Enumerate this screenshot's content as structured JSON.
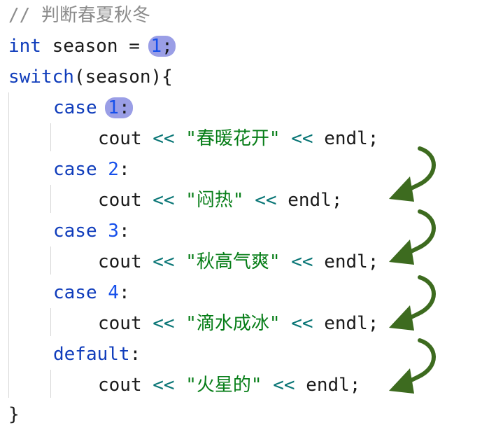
{
  "code": {
    "line1": {
      "comment": "// 判断春夏秋冬"
    },
    "line2": {
      "type": "int",
      "name": " season = ",
      "value": "1",
      "semi": ";"
    },
    "line3": {
      "kw": "switch",
      "rest": "(season){"
    },
    "line4": {
      "kw": "case",
      "value": "1",
      "colon": ":"
    },
    "line5": {
      "cout": "cout",
      "op1": "<<",
      "str": "\"春暖花开\"",
      "op2": "<<",
      "endl": "endl;"
    },
    "line6": {
      "kw": "case",
      "value": "2",
      "colon": ":"
    },
    "line7": {
      "cout": "cout",
      "op1": "<<",
      "str": "\"闷热\"",
      "op2": "<<",
      "endl": "endl;"
    },
    "line8": {
      "kw": "case",
      "value": "3",
      "colon": ":"
    },
    "line9": {
      "cout": "cout",
      "op1": "<<",
      "str": "\"秋高气爽\"",
      "op2": "<<",
      "endl": "endl;"
    },
    "line10": {
      "kw": "case",
      "value": "4",
      "colon": ":"
    },
    "line11": {
      "cout": "cout",
      "op1": "<<",
      "str": "\"滴水成冰\"",
      "op2": "<<",
      "endl": "endl;"
    },
    "line12": {
      "kw": "default",
      "colon": ":"
    },
    "line13": {
      "cout": "cout",
      "op1": "<<",
      "str": "\"火星的\"",
      "op2": "<<",
      "endl": "endl;"
    },
    "line14": {
      "brace": "}"
    }
  },
  "colors": {
    "keyword": "#0f3cbb",
    "number": "#1750eb",
    "operator": "#087575",
    "string": "#067d17",
    "comment": "#8c8c8c",
    "highlight": "#9a9ee6",
    "arrow": "#3d6b1f"
  },
  "icons": [
    "fallthrough-arrow-icon"
  ]
}
